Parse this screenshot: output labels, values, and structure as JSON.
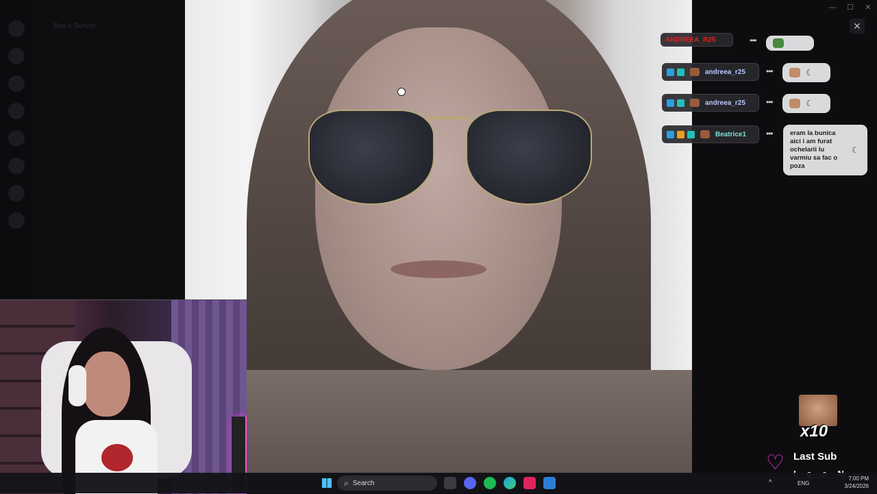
{
  "background_app": {
    "server_name": "Bax's Server"
  },
  "window_controls": [
    "—",
    "☐",
    "✕"
  ],
  "chat": {
    "messages": [
      {
        "username": "ANDREEA_R25",
        "emote": "emote",
        "style": "partial-top"
      },
      {
        "username": "andreea_r25",
        "emote": "emote-moon",
        "text": ""
      },
      {
        "username": "andreea_r25",
        "emote": "emote-moon",
        "text": ""
      },
      {
        "username": "Beatrice1",
        "text": "eram la bunica aici i am furat ochelarii lu varmiu sa fac o poza"
      }
    ],
    "more_glyph": "•••",
    "moon_glyph": "☾"
  },
  "close_label": "✕",
  "last_sub": {
    "multiplier": "x10",
    "title": "Last Sub",
    "name": "I_o_a_N",
    "accent": "#e23ad6"
  },
  "taskbar": {
    "search_placeholder": "Search",
    "search_icon": "magnifier-icon",
    "tray_chevron": "^",
    "language": "ENG",
    "time": "7:00 PM",
    "date": "3/24/2026",
    "apps": [
      "file-explorer-icon",
      "discord-icon",
      "spotify-icon",
      "edge-icon",
      "tiktok-icon",
      "app-icon"
    ]
  }
}
